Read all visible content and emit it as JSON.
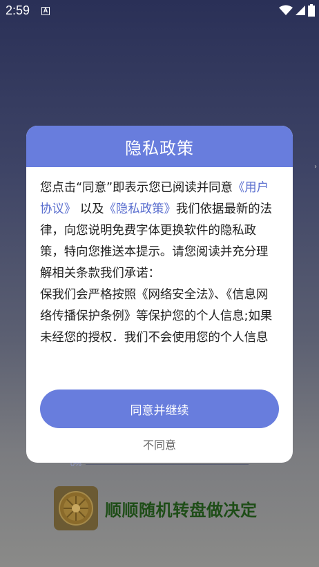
{
  "status_bar": {
    "time": "2:59",
    "notification_glyph": "A",
    "icons": [
      "wifi-icon",
      "signal-icon",
      "battery-icon"
    ]
  },
  "background_app": {
    "progress_label": "0%",
    "footer_title": "顺顺随机转盘做决定"
  },
  "dialog": {
    "title": "隐私政策",
    "intro_prefix": "您点击“同意”即表示您已阅读并同意",
    "link_user_agreement": "《用户协议》",
    "and_text": "以及",
    "link_privacy_policy": "《隐私政策》",
    "intro_suffix": "我们依据最新的法律，向您说明免费字体更换软件的隐私政策，特向您推送本提示。请您阅读并充分理解相关条款我们承诺：",
    "paragraph_2": "保我们会严格按照《网络安全法》、《信息网络传播保护条例》等保护您的个人信息;如果未经您的授权．我们不会使用您的个人信息",
    "agree_button": "同意并继续",
    "disagree_button": "不同意"
  },
  "colors": {
    "accent": "#687ddd",
    "link": "#5b6fcf",
    "footer_title": "#1e4d17"
  }
}
